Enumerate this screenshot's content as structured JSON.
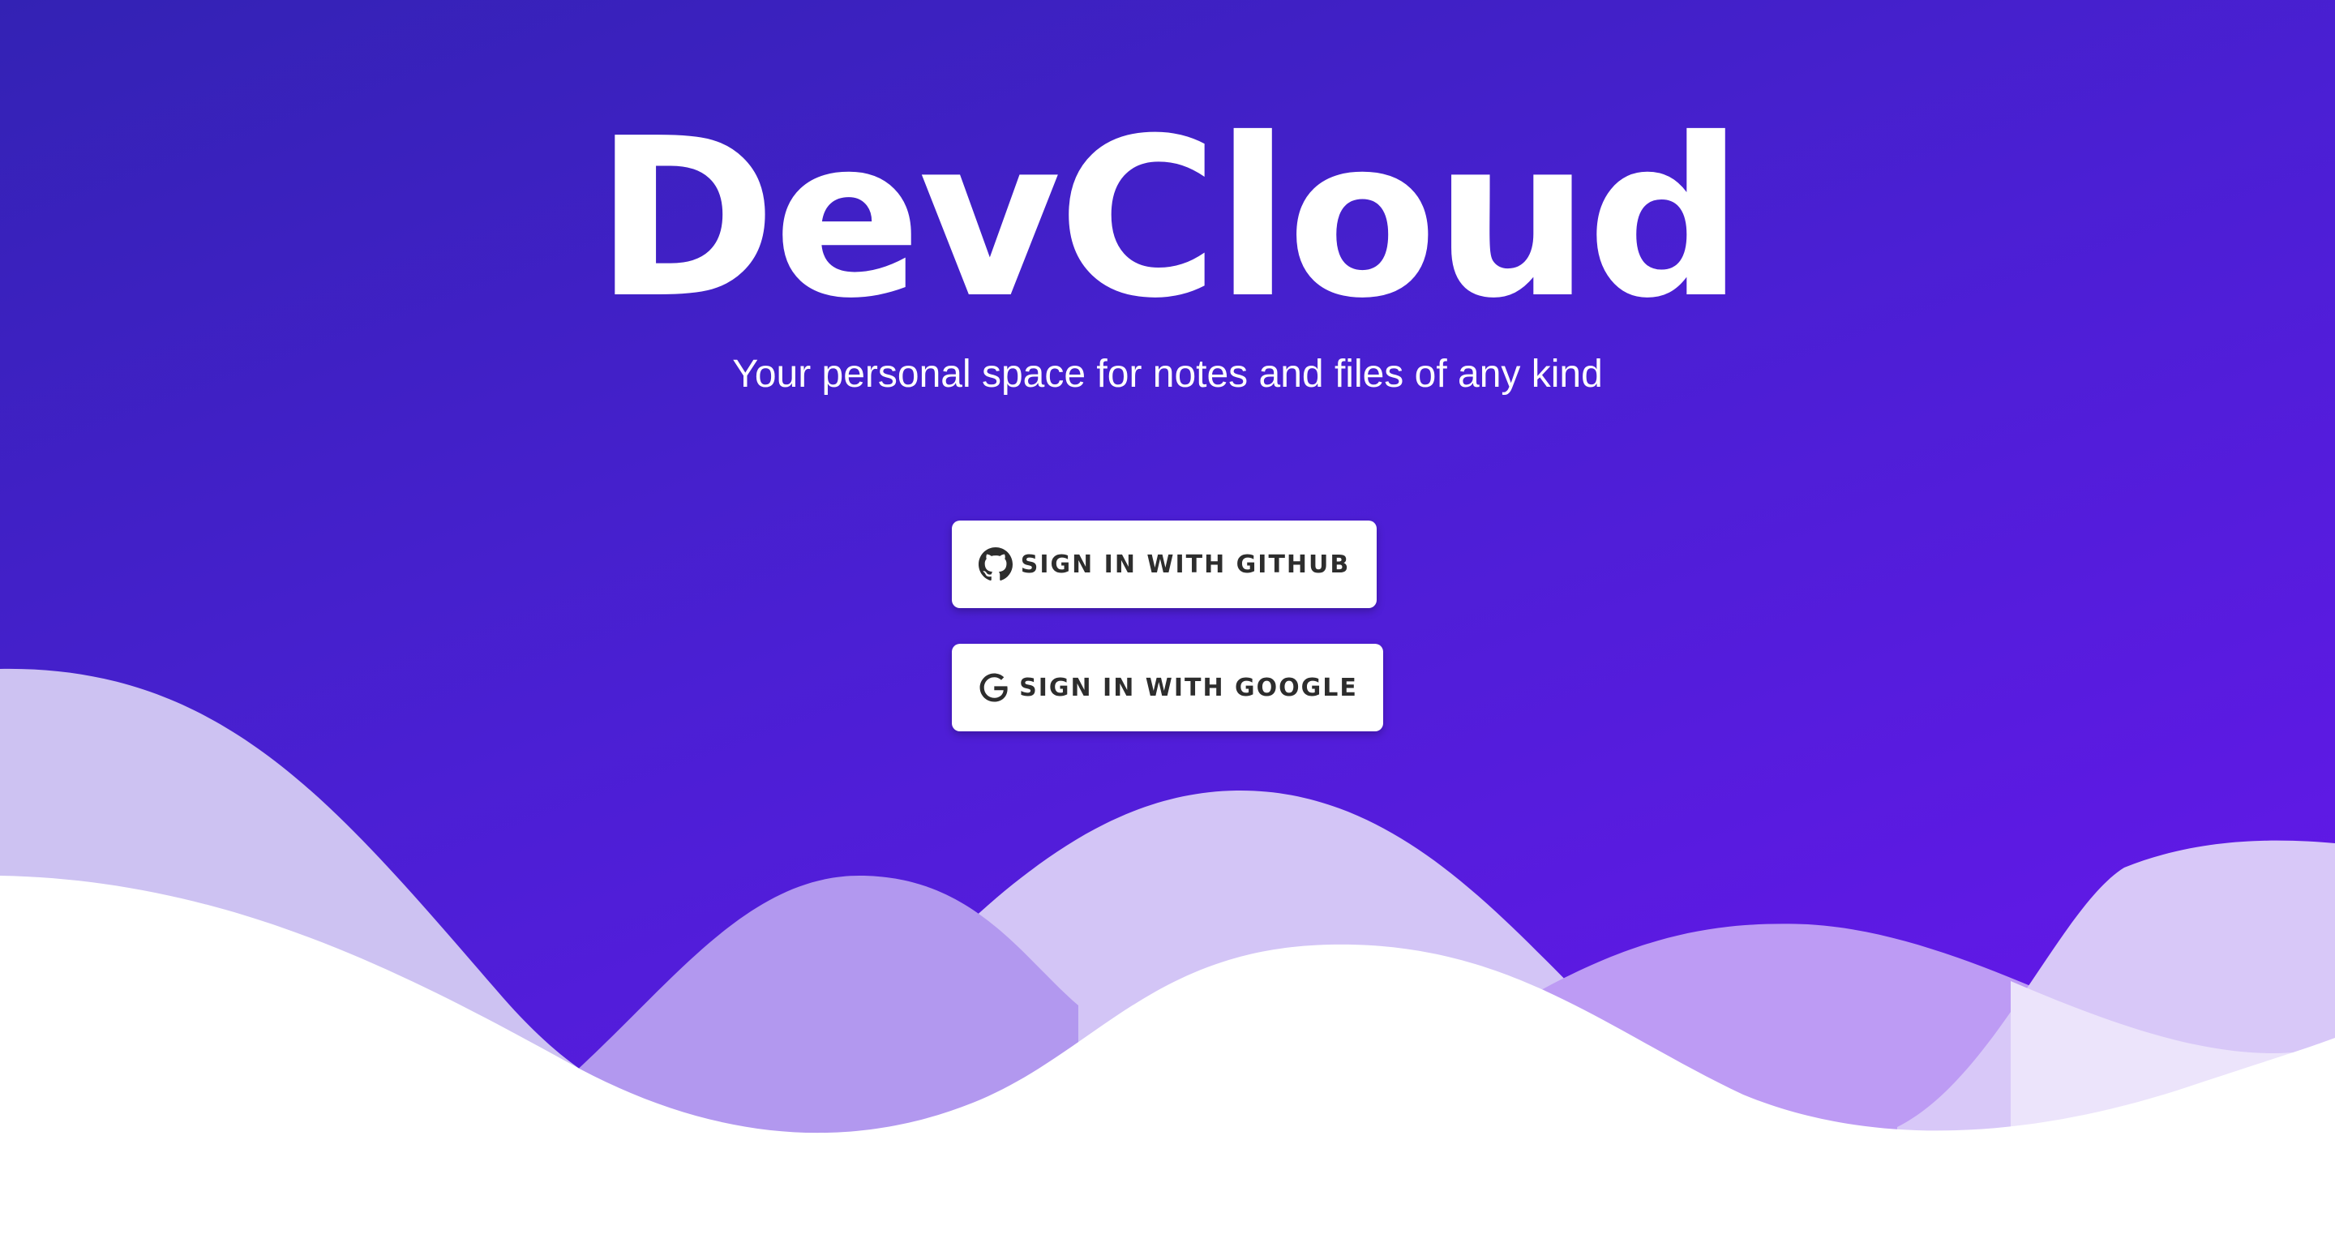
{
  "app": {
    "title": "DevCloud",
    "subtitle": "Your personal space for notes and files of any kind"
  },
  "auth": {
    "github_label": "SIGN IN WITH GITHUB",
    "github_icon": "github-icon",
    "google_label": "SIGN IN WITH GOOGLE",
    "google_icon": "google-icon"
  },
  "colors": {
    "gradient_start": "#3322b4",
    "gradient_end": "#6a16ee",
    "wave_light": "#e8e2f8",
    "wave_mid": "#c9bdf2",
    "wave_purple": "#b596f2",
    "button_text": "#2d2d2d"
  }
}
